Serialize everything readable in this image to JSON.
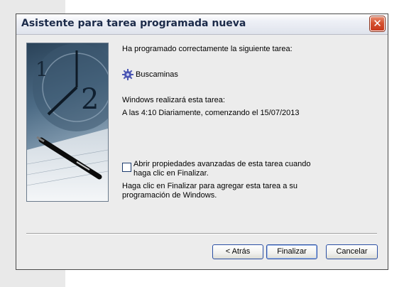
{
  "window": {
    "title": "Asistente para tarea programada nueva",
    "close_glyph": "✕"
  },
  "main": {
    "intro": "Ha programado correctamente la siguiente tarea:",
    "task_icon": "gear-icon",
    "task_name": "Buscaminas",
    "run_header": "Windows realizará esta tarea:",
    "schedule": "A las 4:10 Diariamente, comenzando el 15/07/2013",
    "checkbox_label": "Abrir propiedades avanzadas de esta tarea cuando haga clic en Finalizar.",
    "checkbox_checked": false,
    "finish_hint": "Haga clic en Finalizar para agregar esta tarea a su programación de Windows."
  },
  "buttons": {
    "back": "< Atrás",
    "finish": "Finalizar",
    "cancel": "Cancelar"
  }
}
